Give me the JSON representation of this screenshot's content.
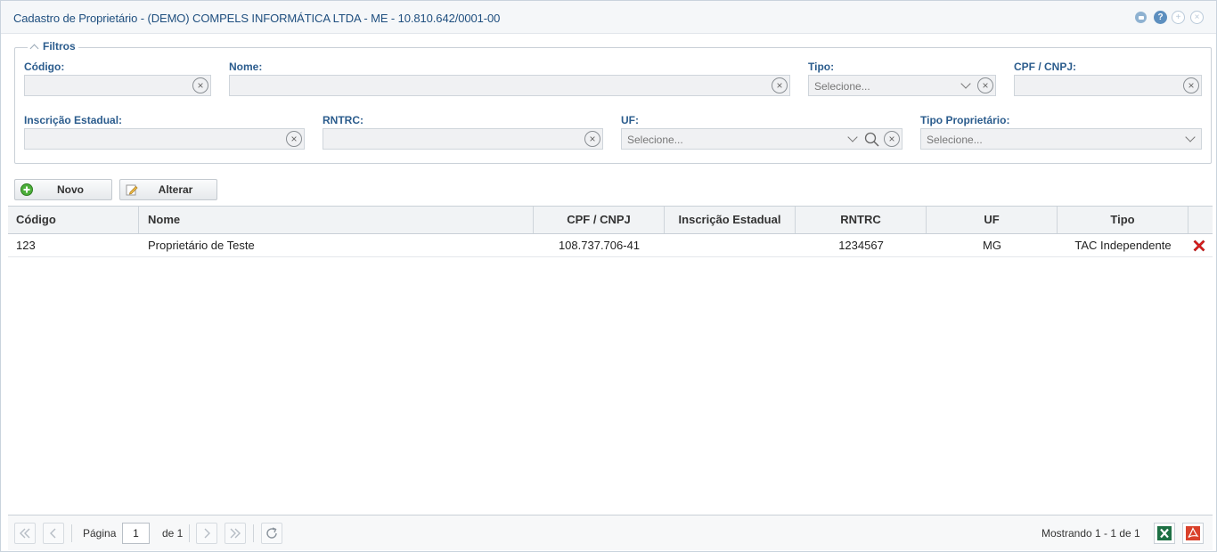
{
  "window": {
    "title": "Cadastro de Proprietário - (DEMO) COMPELS INFORMÁTICA LTDA - ME - 10.810.642/0001-00",
    "icons": [
      "minimize-icon",
      "help-icon",
      "maximize-icon",
      "close-icon"
    ],
    "help_glyph": "?",
    "max_glyph": "+",
    "close_glyph": "×"
  },
  "filters": {
    "legend": "Filtros",
    "codigo": {
      "label": "Código:",
      "value": "",
      "placeholder": ""
    },
    "nome": {
      "label": "Nome:",
      "value": "",
      "placeholder": ""
    },
    "tipo": {
      "label": "Tipo:",
      "selected": "Selecione..."
    },
    "cpf_cnpj": {
      "label": "CPF / CNPJ:",
      "value": "",
      "placeholder": ""
    },
    "inscricao_estadual": {
      "label": "Inscrição Estadual:",
      "value": "",
      "placeholder": ""
    },
    "rntrc": {
      "label": "RNTRC:",
      "value": "",
      "placeholder": ""
    },
    "uf": {
      "label": "UF:",
      "selected": "Selecione..."
    },
    "tipo_proprietario": {
      "label": "Tipo Proprietário:",
      "selected": "Selecione..."
    },
    "clear_glyph": "×"
  },
  "toolbar": {
    "novo_label": "Novo",
    "alterar_label": "Alterar"
  },
  "grid": {
    "columns": [
      "Código",
      "Nome",
      "CPF / CNPJ",
      "Inscrição Estadual",
      "RNTRC",
      "UF",
      "Tipo"
    ],
    "rows": [
      {
        "codigo": "123",
        "nome": "Proprietário de Teste",
        "cpf_cnpj": "108.737.706-41",
        "inscricao_estadual": "",
        "rntrc": "1234567",
        "uf": "MG",
        "tipo": "TAC Independente"
      }
    ]
  },
  "pager": {
    "page_label": "Página",
    "page_value": "1",
    "of_label": "de 1",
    "status": "Mostrando 1 - 1 de 1"
  },
  "colors": {
    "title": "#1f4f7f",
    "label": "#2b5c8d",
    "excel": "#1d7044",
    "pdf": "#d9412b",
    "delete": "#e02020"
  }
}
